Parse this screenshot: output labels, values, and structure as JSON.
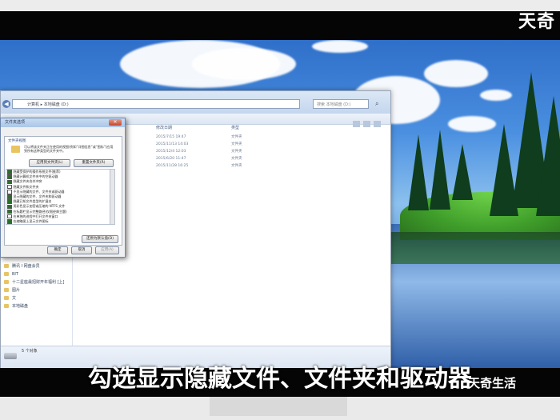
{
  "brand": {
    "text": "天奇"
  },
  "watermark": {
    "text": "天奇生活"
  },
  "caption": {
    "text": "勾选显示隐藏文件、文件夹和驱动器"
  },
  "explorer": {
    "address": "计算机 ▸ 本地磁盘 (D:)",
    "search_placeholder": "搜索 本地磁盘 (D:)",
    "columns": {
      "date": "修改日期",
      "type": "类型"
    },
    "files": [
      {
        "date": "2015/7/15 19:47",
        "type": "文件夹"
      },
      {
        "date": "2015/11/13 14:03",
        "type": "文件夹"
      },
      {
        "date": "2015/12/4 12:03",
        "type": "文件夹"
      },
      {
        "date": "2015/6/20 11:47",
        "type": "文件夹"
      },
      {
        "date": "2015/11/28 16:25",
        "type": "文件夹"
      }
    ],
    "nav_items": [
      {
        "label": "腾讯 I 网盘会员"
      },
      {
        "label": "BIT"
      },
      {
        "label": "十二星座最招财开年福利 [上]"
      },
      {
        "label": "图片"
      },
      {
        "label": "文"
      },
      {
        "label": "本地磁盘"
      }
    ],
    "status": "5 个对象"
  },
  "dialog": {
    "title": "文件夹选项",
    "tabs": [
      "常规",
      "查看",
      "搜索"
    ],
    "active_tab": "查看",
    "group1": "文件夹视图",
    "group1_desc": "可以将该文件夹正在使用的视图(例如“详细信息”或“图标”)应用到所有这种类型的文件夹中。",
    "apply_folders": "应用到文件夹(L)",
    "reset_folders": "重置文件夹(R)",
    "group2": "高级设置:",
    "settings": [
      {
        "label": "隐藏受保护的操作系统文件(推荐)",
        "checked": true
      },
      {
        "label": "隐藏计算机文件夹中的空驱动器",
        "checked": true
      },
      {
        "label": "隐藏文件夹合并冲突",
        "checked": true
      },
      {
        "label": "隐藏文件和文件夹",
        "checked": false
      },
      {
        "label": "不显示隐藏的文件、文件夹或驱动器",
        "checked": false
      },
      {
        "label": "显示隐藏的文件、文件夹和驱动器",
        "checked": true
      },
      {
        "label": "隐藏已知文件类型的扩展名",
        "checked": true
      },
      {
        "label": "用彩色显示加密或压缩的 NTFS 文件",
        "checked": true
      },
      {
        "label": "在标题栏显示完整路径(仅限经典主题)",
        "checked": true
      },
      {
        "label": "在单独的进程中打开文件夹窗口",
        "checked": false
      },
      {
        "label": "在缩略图上显示文件图标",
        "checked": true
      },
      {
        "label": "在文件夹提示中显示文件大小信息",
        "checked": true
      },
      {
        "label": "在预览窗格中显示预览句柄",
        "checked": true
      }
    ],
    "restore_defaults": "还原为默认值(D)",
    "ok": "确定",
    "cancel": "取消",
    "apply": "应用(A)"
  }
}
